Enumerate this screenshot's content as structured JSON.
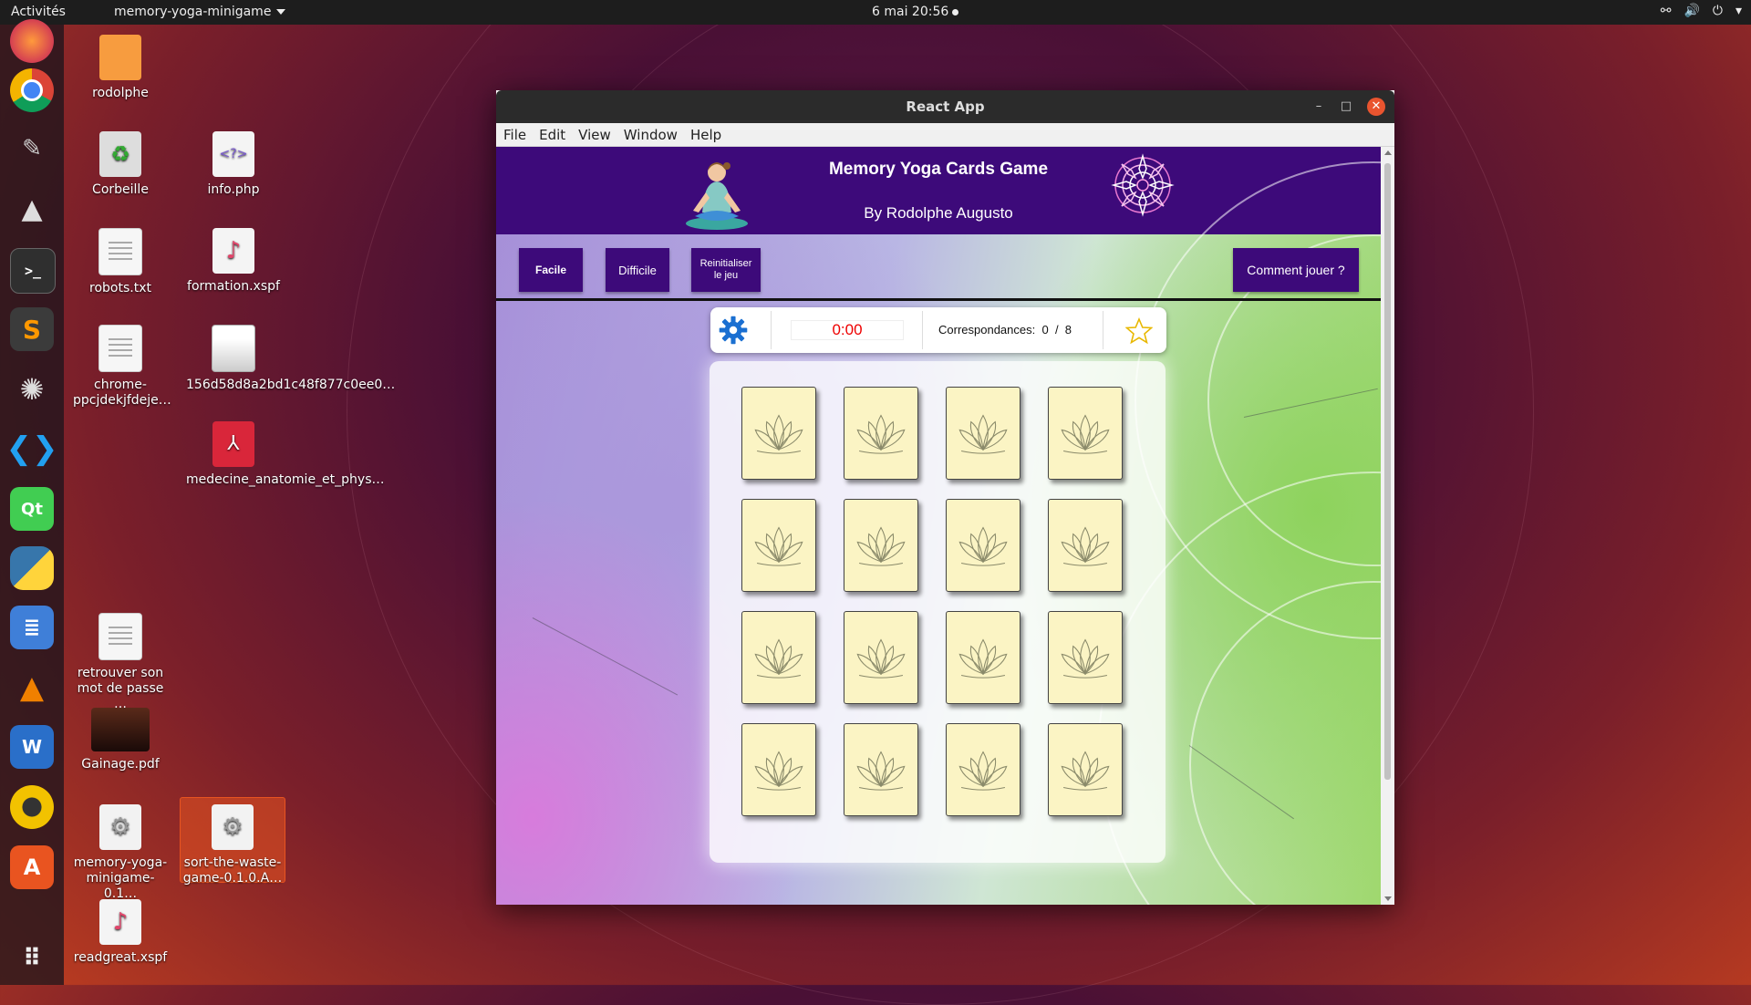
{
  "topbar": {
    "activities": "Activités",
    "app_menu": "memory-yoga-minigame",
    "clock": "6 mai  20:56"
  },
  "desktop": {
    "icons": [
      {
        "label": "rodolphe",
        "icon": "home-folder-icon"
      },
      {
        "label": "Corbeille",
        "icon": "trash-icon"
      },
      {
        "label": "info.php",
        "icon": "php-file-icon"
      },
      {
        "label": "robots.txt",
        "icon": "text-file-icon"
      },
      {
        "label": "formation.xspf",
        "icon": "playlist-file-icon"
      },
      {
        "label": "chrome-ppcjdekjfdeje…",
        "icon": "text-file-icon"
      },
      {
        "label": "156d58d8a2bd1c48f877c0ee0…",
        "icon": "pdf-thumbnail-icon"
      },
      {
        "label": "medecine_anatomie_et_phys…",
        "icon": "pdf-file-icon"
      },
      {
        "label": "retrouver son mot de passe …",
        "icon": "text-file-icon"
      },
      {
        "label": "Gainage.pdf",
        "icon": "pdf-thumbnail-icon"
      },
      {
        "label": "memory-yoga-minigame-0.1…",
        "icon": "appimage-icon"
      },
      {
        "label": "sort-the-waste-game-0.1.0.A…",
        "icon": "appimage-icon"
      },
      {
        "label": "readgreat.xspf",
        "icon": "playlist-file-icon"
      }
    ]
  },
  "dock": {
    "items": [
      "firefox-icon",
      "chrome-icon",
      "gimp-icon",
      "inkscape-icon",
      "terminal-icon",
      "sublime-icon",
      "network-icon",
      "vscode-icon",
      "qt-creator-icon",
      "python-icon",
      "files-icon",
      "vlc-icon",
      "writer-icon",
      "rhythmbox-icon",
      "software-icon",
      "grid-apps-icon"
    ]
  },
  "window": {
    "title": "React App",
    "menu": [
      "File",
      "Edit",
      "View",
      "Window",
      "Help"
    ]
  },
  "app": {
    "title": "Memory Yoga Cards Game",
    "author": "By Rodolphe Augusto",
    "buttons": {
      "easy": "Facile",
      "hard": "Difficile",
      "reset_line1": "Reinitialiser",
      "reset_line2": "le jeu",
      "howto": "Comment jouer ?"
    },
    "status": {
      "timer": "0:00",
      "matches_label": "Correspondances:",
      "matches_found": "0",
      "matches_sep": "/",
      "matches_total": "8"
    },
    "colors": {
      "primary": "#3d0a7a",
      "card_back": "#fbf4c4",
      "timer_text": "#e00000",
      "gear": "#1a6fd1"
    },
    "cards_count": 16
  }
}
